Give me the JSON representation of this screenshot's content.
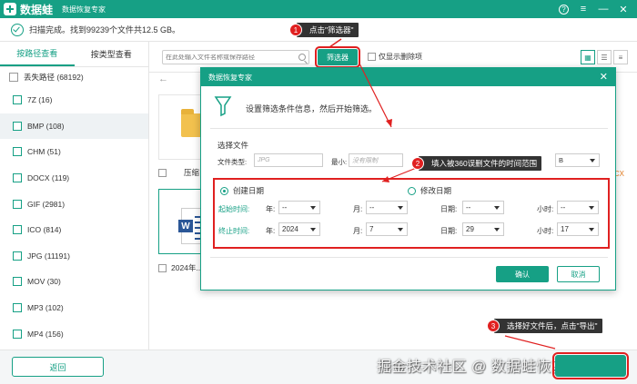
{
  "titlebar": {
    "brand": "数据蛙",
    "app_name": "数据恢复专家",
    "help_icon": "?"
  },
  "scan": {
    "status_text": "扫描完成。找到99239个文件共12.5 GB。"
  },
  "left_panel": {
    "tabs": [
      "按路径查看",
      "按类型查看"
    ],
    "root": "丢失路径 (68192)",
    "items": [
      {
        "label": "7Z (16)"
      },
      {
        "label": "BMP (108)"
      },
      {
        "label": "CHM (51)"
      },
      {
        "label": "DOCX (119)"
      },
      {
        "label": "GIF (2981)"
      },
      {
        "label": "ICO (814)"
      },
      {
        "label": "JPG (11191)"
      },
      {
        "label": "MOV (30)"
      },
      {
        "label": "MP3 (102)"
      },
      {
        "label": "MP4 (156)"
      }
    ]
  },
  "toolbar": {
    "search_placeholder": "在此处输入文件名称或保存路径",
    "filter_label": "筛选器",
    "show_deleted_label": "仅显示删除项"
  },
  "content": {
    "card1_label": "压缩",
    "card2_label": "2024年...",
    "right_fragment": "CX"
  },
  "bottom": {
    "back_label": "返回",
    "watermark": "掘金技术社区 @ 数据蛙恢复软件",
    "watermark_behind": "选择好文件后，点击\"导出\""
  },
  "dialog": {
    "title": "数据恢复专家",
    "instruction": "设置筛选条件信息，然后开始筛选。",
    "section_label": "选择文件",
    "filetype_label": "文件类型:",
    "filetype_placeholder": "JPG",
    "min_label": "最小:",
    "min_placeholder": "没有限制",
    "size_select_fragment": "B",
    "radio_created": "创建日期",
    "radio_modified": "修改日期",
    "start_label": "起始时间:",
    "end_label": "终止时间:",
    "year_label": "年:",
    "month_label": "月:",
    "day_label": "日期:",
    "hour_label": "小时:",
    "start": {
      "year": "--",
      "month": "--",
      "day": "--",
      "hour": "--"
    },
    "end": {
      "year": "2024",
      "month": "7",
      "day": "29",
      "hour": "17"
    },
    "ok_label": "确认",
    "cancel_label": "取消"
  },
  "annotations": [
    {
      "num": "1",
      "text": "点击\"筛选器\""
    },
    {
      "num": "2",
      "text": "填入被360误删文件的时间范围"
    },
    {
      "num": "3",
      "text": "选择好文件后，点击\"导出\""
    }
  ],
  "colors": {
    "accent": "#16a085",
    "highlight_red": "#e02020",
    "annotation_bg": "#333333"
  }
}
